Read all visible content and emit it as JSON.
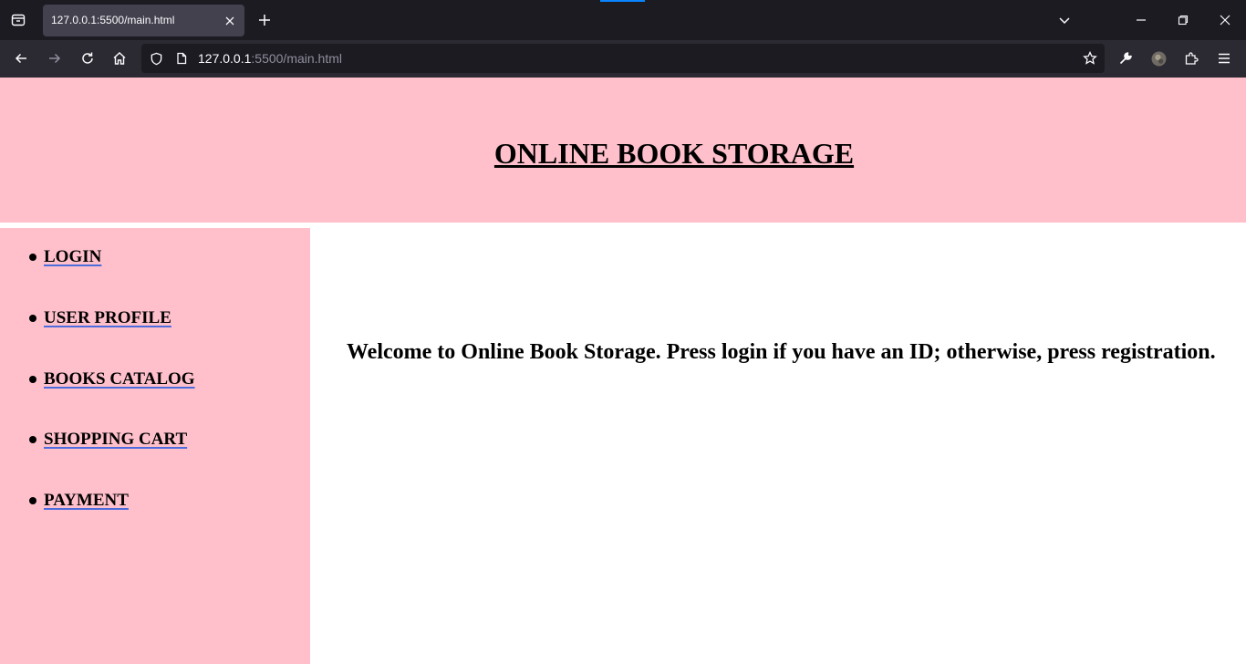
{
  "browser": {
    "tab_title": "127.0.0.1:5500/main.html",
    "url_host": "127.0.0.1",
    "url_path": ":5500/main.html"
  },
  "site": {
    "title": "ONLINE BOOK STORAGE",
    "menu": [
      {
        "label": "LOGIN"
      },
      {
        "label": "USER PROFILE"
      },
      {
        "label": "BOOKS CATALOG"
      },
      {
        "label": "SHOPPING CART"
      },
      {
        "label": "PAYMENT"
      }
    ],
    "welcome": "Welcome to Online Book Storage. Press login if you have an ID; otherwise, press registration."
  },
  "colors": {
    "header_bg": "#ffc0cb",
    "sidebar_bg": "#ffc0cb",
    "link_underline": "#4b6cdd"
  }
}
